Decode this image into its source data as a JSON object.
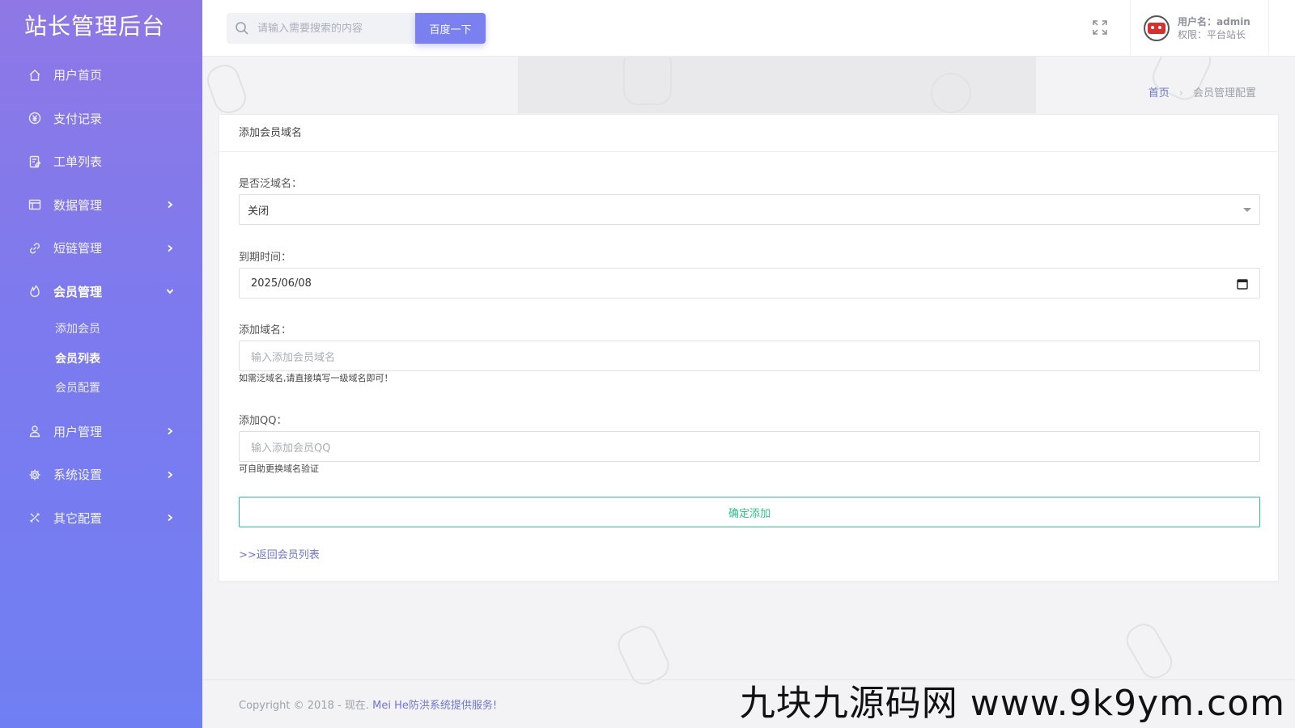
{
  "app": {
    "title": "站长管理后台"
  },
  "sidebar": {
    "items": [
      {
        "label": "用户首页",
        "icon": "home-icon"
      },
      {
        "label": "支付记录",
        "icon": "yen-icon"
      },
      {
        "label": "工单列表",
        "icon": "ticket-icon"
      },
      {
        "label": "数据管理",
        "icon": "database-icon"
      },
      {
        "label": "短链管理",
        "icon": "link-icon"
      },
      {
        "label": "会员管理",
        "icon": "fire-icon"
      },
      {
        "label": "用户管理",
        "icon": "user-icon"
      },
      {
        "label": "系统设置",
        "icon": "gear-icon"
      },
      {
        "label": "其它配置",
        "icon": "tools-icon"
      }
    ],
    "member_sub": [
      "添加会员",
      "会员列表",
      "会员配置"
    ]
  },
  "header": {
    "search_placeholder": "请输入需要搜索的内容",
    "search_button": "百度一下",
    "username_label": "用户名：admin",
    "role_label": "权限：平台站长"
  },
  "breadcrumb": {
    "home": "首页",
    "current": "会员管理配置"
  },
  "form": {
    "title": "添加会员域名",
    "wildcard_label": "是否泛域名：",
    "wildcard_value": "关闭",
    "expire_label": "到期时间：",
    "expire_value": "2025/06/08",
    "domain_label": "添加域名：",
    "domain_placeholder": "输入添加会员域名",
    "domain_help": "如需泛域名,请直接填写一级域名即可！",
    "qq_label": "添加QQ：",
    "qq_placeholder": "输入添加会员QQ",
    "qq_help": "可自助更换域名验证",
    "submit_label": "确定添加",
    "back_link": ">>返回会员列表"
  },
  "footer": {
    "copyright": "Copyright © 2018 - 现在.",
    "brand": "Mei He防洪系统提供服务!"
  },
  "watermark": "九块九源码网 www.9k9ym.com",
  "colors": {
    "sidebar_top": "#8f78e6",
    "sidebar_bottom": "#6f7ff3",
    "accent": "#7a80ef",
    "success": "#2ec28b"
  }
}
